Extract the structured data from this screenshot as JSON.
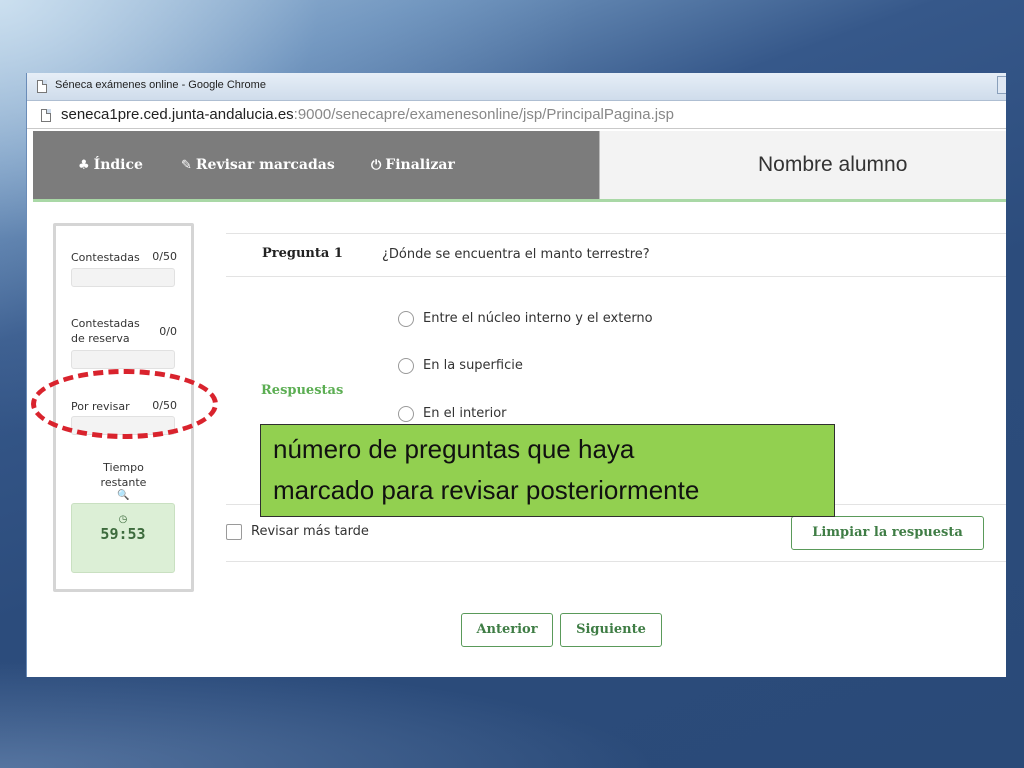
{
  "window": {
    "title": "Séneca exámenes online - Google Chrome",
    "url_host": "seneca1pre.ced.junta-andalucia.es",
    "url_path": ":9000/senecapre/examenesonline/jsp/PrincipalPagina.jsp"
  },
  "navbar": {
    "items": [
      {
        "icon": "sitemap-icon",
        "glyph": "♣",
        "label": "Índice"
      },
      {
        "icon": "pencil-icon",
        "glyph": "✎",
        "label": "Revisar marcadas"
      },
      {
        "icon": "power-icon",
        "glyph": "⏻",
        "label": "Finalizar"
      }
    ],
    "student_name": "Nombre alumno",
    "bg_color": "#7c7c7c",
    "accent_color": "#a9d8a6"
  },
  "status": {
    "answered": {
      "label": "Contestadas",
      "value": "0/50"
    },
    "reserve": {
      "label_line1": "Contestadas",
      "label_line2": "de reserva",
      "value": "0/0"
    },
    "to_review": {
      "label": "Por revisar",
      "value": "0/50"
    },
    "time": {
      "label_line1": "Tiempo",
      "label_line2": "restante",
      "zoom_glyph": "🔍",
      "clock_glyph": "◷",
      "value": "59:53"
    }
  },
  "question": {
    "label": "Pregunta 1",
    "text": "¿Dónde se encuentra el manto terrestre?",
    "answers_label": "Respuestas",
    "options": [
      "Entre el núcleo interno y el externo",
      "En la superficie",
      "En el interior"
    ],
    "review_later": "Revisar más tarde",
    "clear_button": "Limpiar la respuesta"
  },
  "pager": {
    "previous": "Anterior",
    "next": "Siguiente"
  },
  "callout": {
    "line1": "número de preguntas que haya",
    "line2": "marcado para revisar posteriormente",
    "bg_color": "#92d050",
    "ellipse_color": "#d9232d"
  }
}
